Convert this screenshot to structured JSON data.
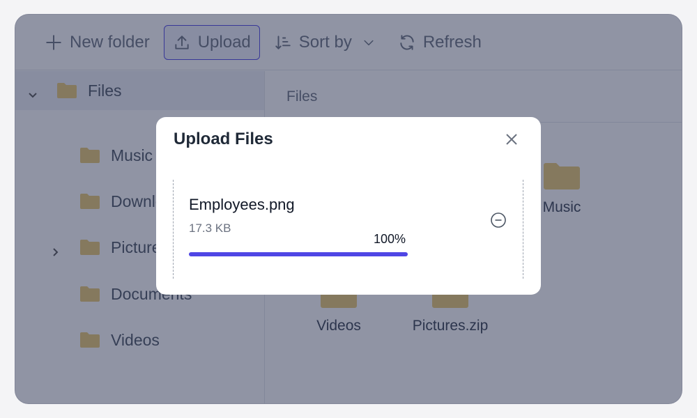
{
  "toolbar": {
    "new_folder": "New folder",
    "upload": "Upload",
    "sort_by": "Sort by",
    "refresh": "Refresh"
  },
  "sidebar": {
    "root": "Files",
    "items": [
      {
        "label": "Music",
        "expandable": false
      },
      {
        "label": "Downloads",
        "expandable": false
      },
      {
        "label": "Pictures",
        "expandable": true
      },
      {
        "label": "Documents",
        "expandable": false
      },
      {
        "label": "Videos",
        "expandable": false
      }
    ]
  },
  "content": {
    "breadcrumb": "Files",
    "items": [
      {
        "label": "Music"
      },
      {
        "label": "Videos"
      },
      {
        "label": "Pictures.zip"
      }
    ]
  },
  "modal": {
    "title": "Upload Files",
    "file": {
      "name": "Employees.png",
      "size": "17.3 KB",
      "percent_text": "100%",
      "progress": 1.0
    }
  },
  "colors": {
    "accent": "#4f46e5",
    "folder": "#e8c872",
    "overlay": "rgba(34,42,74,0.50)"
  }
}
